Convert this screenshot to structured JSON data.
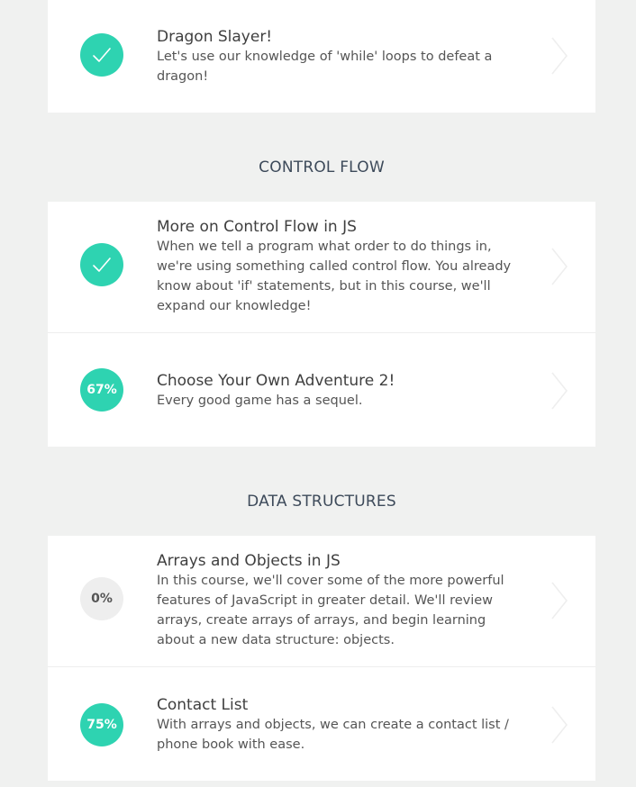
{
  "sections": [
    {
      "heading": "",
      "lessons": [
        {
          "title": "Dragon Slayer!",
          "description": "Let's use our knowledge of 'while' loops to defeat a dragon!",
          "status": "complete",
          "status_icon": "checkmark-icon"
        }
      ]
    },
    {
      "heading": "CONTROL FLOW",
      "lessons": [
        {
          "title": "More on Control Flow in JS",
          "description": "When we tell a program what order to do things in, we're using something called control flow. You already know about 'if' statements, but in this course, we'll expand our knowledge!",
          "status": "complete",
          "status_icon": "checkmark-icon"
        },
        {
          "title": "Choose Your Own Adventure 2!",
          "description": "Every good game has a sequel.",
          "status": "in-progress",
          "progress_label": "67%",
          "progress": 0.67
        }
      ]
    },
    {
      "heading": "DATA STRUCTURES",
      "lessons": [
        {
          "title": "Arrays and Objects in JS",
          "description": "In this course, we'll cover some of the more powerful features of JavaScript in greater detail. We'll review arrays, create arrays of arrays, and begin learning about a new data structure: objects.",
          "status": "not-started",
          "progress_label": "0%",
          "progress": 0.0
        },
        {
          "title": "Contact List",
          "description": "With arrays and objects, we can create a contact list / phone book with ease.",
          "status": "in-progress",
          "progress_label": "75%",
          "progress": 0.75
        }
      ]
    }
  ],
  "colors": {
    "accent": "#2ed3b1",
    "background": "#f0f1f0",
    "card": "#ffffff",
    "not_started": "#eeeeee"
  }
}
